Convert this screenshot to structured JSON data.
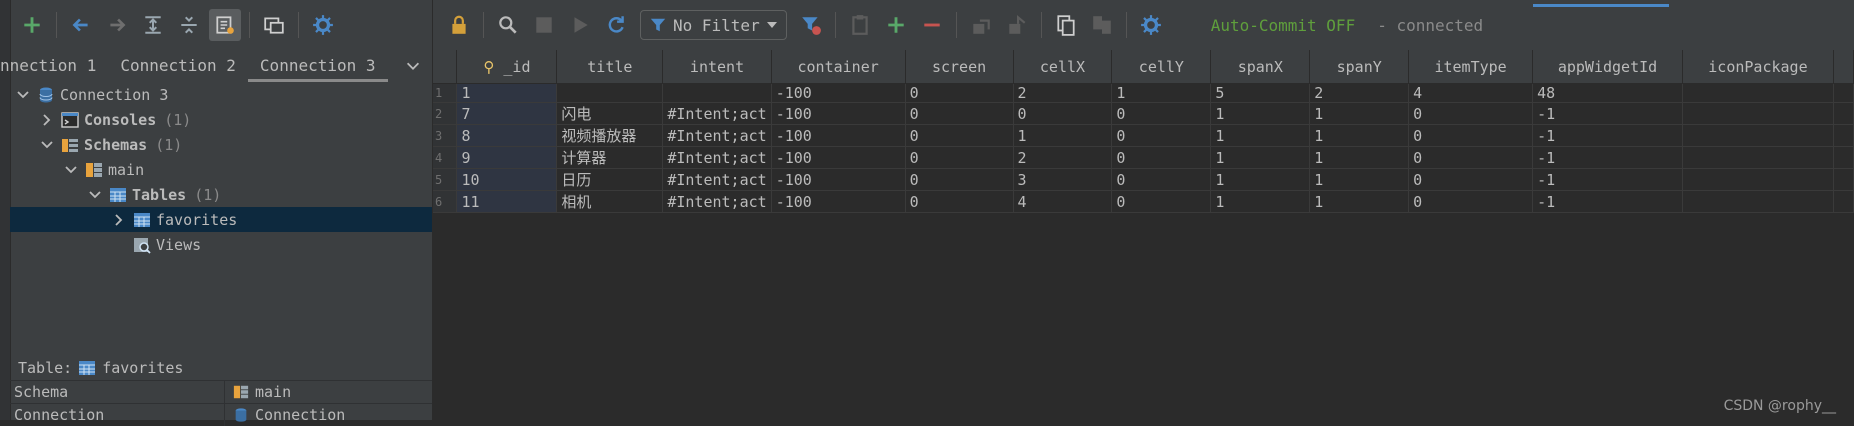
{
  "left_toolbar": {
    "icons": [
      "add-icon",
      "back-icon",
      "forward-icon",
      "collapse-all-icon",
      "expand-all-icon",
      "datasource-properties-icon",
      "console-icon",
      "settings-icon"
    ]
  },
  "connection_tabs": [
    {
      "label": "nnection 1"
    },
    {
      "label": "Connection 2"
    },
    {
      "label": "Connection 3"
    }
  ],
  "tree": {
    "root": "Connection 3",
    "consoles": {
      "label": "Consoles",
      "count": "(1)"
    },
    "schemas": {
      "label": "Schemas",
      "count": "(1)"
    },
    "main": "main",
    "tables": {
      "label": "Tables",
      "count": "(1)"
    },
    "favorites": "favorites",
    "views": "Views"
  },
  "properties": {
    "title_prefix": "Table:",
    "title_value": "favorites",
    "rows": [
      {
        "key": "Schema",
        "value": "main"
      },
      {
        "key": "Connection",
        "value": "Connection"
      }
    ]
  },
  "right_toolbar": {
    "filter_label": "No Filter",
    "auto_commit": "Auto-Commit OFF",
    "status": "- connected"
  },
  "table": {
    "columns": [
      "_id",
      "title",
      "intent",
      "container",
      "screen",
      "cellX",
      "cellY",
      "spanX",
      "spanY",
      "itemType",
      "appWidgetId",
      "iconPackage"
    ],
    "rows": [
      [
        "1",
        "1",
        "",
        "",
        "-100",
        "0",
        "2",
        "1",
        "5",
        "2",
        "4",
        "48",
        ""
      ],
      [
        "2",
        "7",
        "闪电",
        "#Intent;act",
        "-100",
        "0",
        "0",
        "0",
        "1",
        "1",
        "0",
        "-1",
        ""
      ],
      [
        "3",
        "8",
        "视频播放器",
        "#Intent;act",
        "-100",
        "0",
        "1",
        "0",
        "1",
        "1",
        "0",
        "-1",
        ""
      ],
      [
        "4",
        "9",
        "计算器",
        "#Intent;act",
        "-100",
        "0",
        "2",
        "0",
        "1",
        "1",
        "0",
        "-1",
        ""
      ],
      [
        "5",
        "10",
        "日历",
        "#Intent;act",
        "-100",
        "0",
        "3",
        "0",
        "1",
        "1",
        "0",
        "-1",
        ""
      ],
      [
        "6",
        "11",
        "相机",
        "#Intent;act",
        "-100",
        "0",
        "4",
        "0",
        "1",
        "1",
        "0",
        "-1",
        ""
      ]
    ]
  },
  "watermark": "CSDN @rophy__",
  "colors": {
    "panel": "#3c3f41",
    "editor": "#2b2b2b",
    "selection": "#0d293e",
    "accent": "#4a88c7",
    "green": "#5f9f3c",
    "red": "#c75450"
  }
}
